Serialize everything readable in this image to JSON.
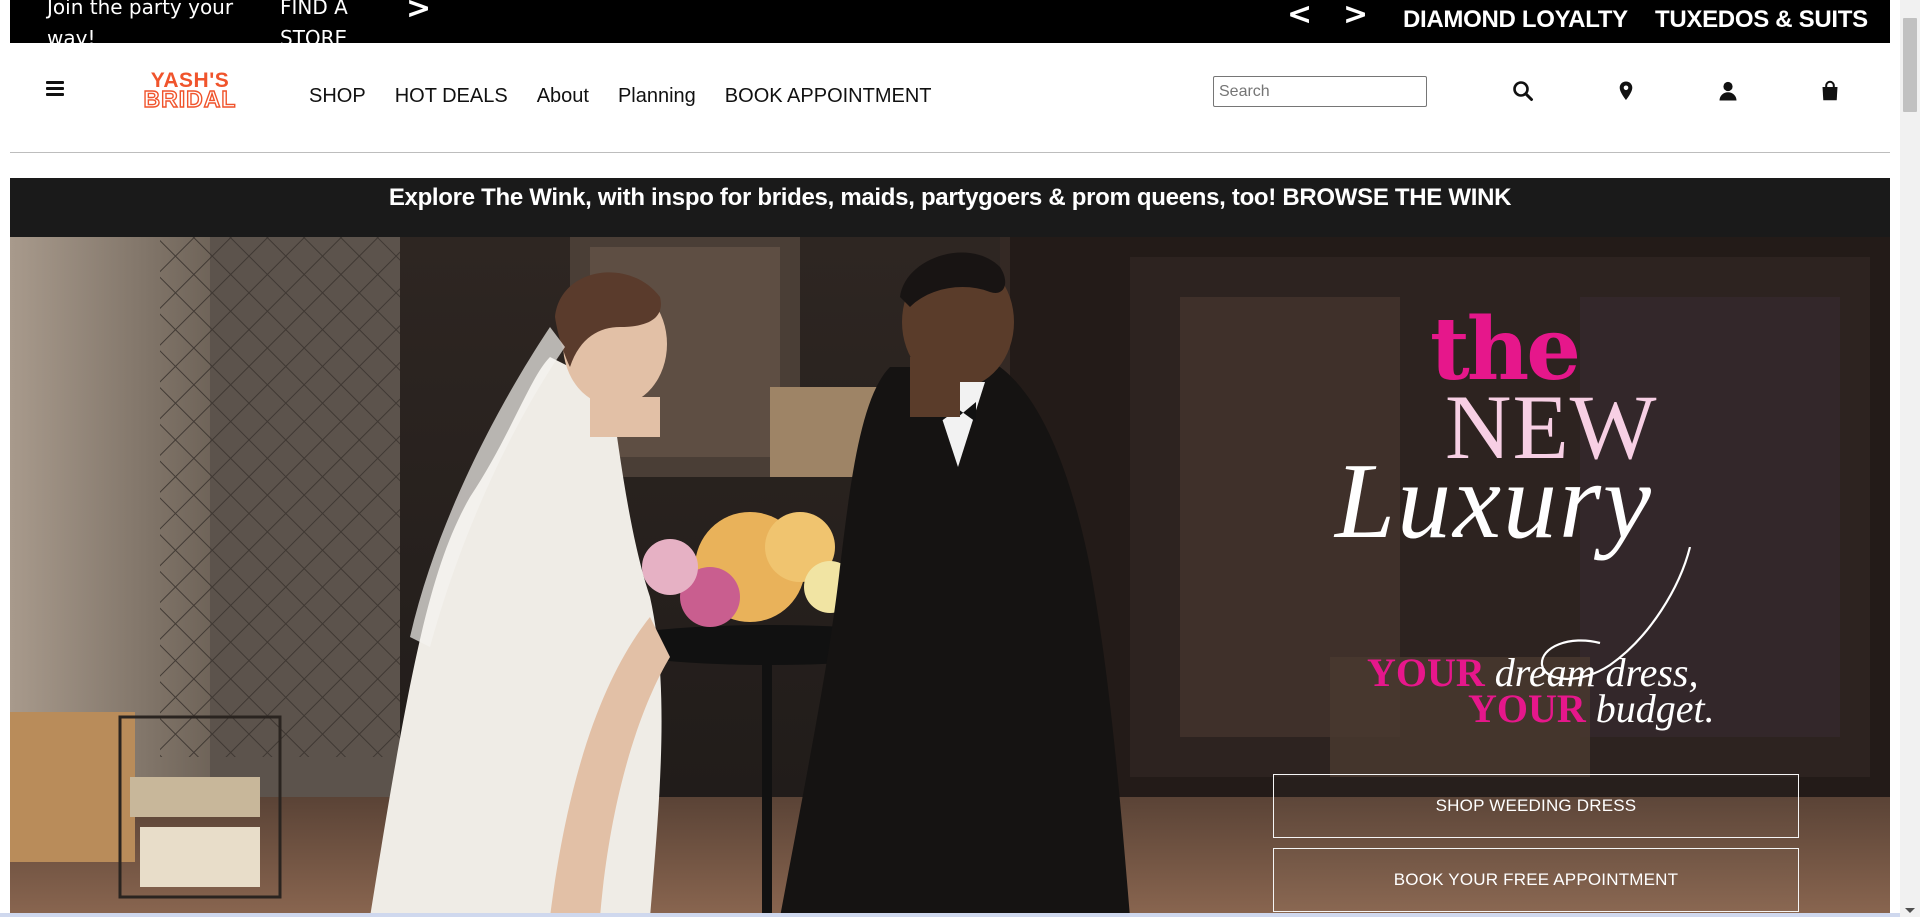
{
  "promo_bar": {
    "text": "Join the party your way!",
    "find_store": "FIND A STORE",
    "arrow_next_first": ">",
    "arrow_prev": "<",
    "arrow_next": ">",
    "links": [
      "DIAMOND LOYALTY",
      "TUXEDOS & SUITS"
    ]
  },
  "header": {
    "logo_line1": "YASH'S",
    "logo_line2": "BRIDAL",
    "nav": [
      "SHOP",
      "HOT DEALS",
      "About",
      "Planning",
      "BOOK APPOINTMENT"
    ],
    "search_placeholder": "Search",
    "icons": [
      "search-icon",
      "map-pin-icon",
      "user-icon",
      "shopping-bag-icon"
    ]
  },
  "announcement": "Explore The Wink, with inspo for brides, maids, partygoers & prom queens, too! BROWSE THE WINK",
  "hero": {
    "tagline_the": "the",
    "tagline_new": "NEW",
    "tagline_luxury": "Luxury",
    "line1_emph": "YOUR",
    "line1_rest": " dream dress,",
    "line2_emph": "YOUR",
    "line2_rest": " budget.",
    "button_shop": "SHOP WEEDING DRESS",
    "button_book": "BOOK YOUR FREE APPOINTMENT"
  },
  "colors": {
    "brand_orange": "#f0542c",
    "hero_pink": "#e6178b",
    "bar_black": "#000000"
  }
}
